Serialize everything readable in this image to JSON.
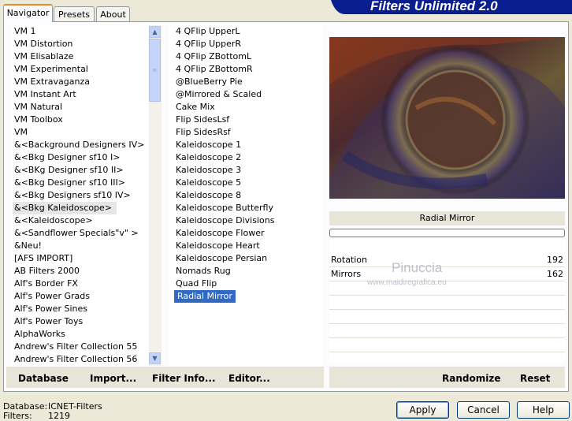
{
  "tabs": [
    "Navigator",
    "Presets",
    "About"
  ],
  "brand": "Filters Unlimited 2.0",
  "categories": [
    "VM 1",
    "VM Distortion",
    "VM Elisablaze",
    "VM Experimental",
    "VM Extravaganza",
    "VM Instant Art",
    "VM Natural",
    "VM Toolbox",
    "VM",
    "&<Background Designers IV>",
    "&<Bkg Designer sf10 I>",
    "&<BKg Designer sf10 II>",
    "&<Bkg Designer sf10 III>",
    "&<Bkg Designers sf10 IV>",
    "&<Bkg Kaleidoscope>",
    "&<Kaleidoscope>",
    "&<Sandflower Specials\"v\" >",
    "&Neu!",
    "[AFS IMPORT]",
    "AB Filters 2000",
    "Alf's Border FX",
    "Alf's Power Grads",
    "Alf's Power Sines",
    "Alf's Power Toys",
    "AlphaWorks",
    "Andrew's Filter Collection 55",
    "Andrew's Filter Collection 56"
  ],
  "filters": [
    "4 QFlip UpperL",
    "4 QFlip UpperR",
    "4 QFlip ZBottomL",
    "4 QFlip ZBottomR",
    "@BlueBerry Pie",
    "@Mirrored & Scaled",
    "Cake Mix",
    "Flip SidesLsf",
    "Flip SidesRsf",
    "Kaleidoscope 1",
    "Kaleidoscope 2",
    "Kaleidoscope 3",
    "Kaleidoscope 5",
    "Kaleidoscope 8",
    "Kaleidoscope Butterfly",
    "Kaleidoscope Divisions",
    "Kaleidoscope Flower",
    "Kaleidoscope Heart",
    "Kaleidoscope Persian",
    "Nomads Rug",
    "Quad Flip",
    "Radial Mirror"
  ],
  "filter_name": "Radial Mirror",
  "params": [
    {
      "label": "Rotation",
      "value": "192"
    },
    {
      "label": "Mirrors",
      "value": "162"
    }
  ],
  "watermark": {
    "line1": "Pinuccia",
    "line2": "www.maidiregrafica.eu"
  },
  "left_buttons": [
    "Database",
    "Import...",
    "Filter Info...",
    "Editor..."
  ],
  "right_buttons": [
    "Randomize",
    "Reset"
  ],
  "status": {
    "database_label": "Database:",
    "database_value": "ICNET-Filters",
    "filters_label": "Filters:",
    "filters_value": "1219"
  },
  "dialog_buttons": [
    "Apply",
    "Cancel",
    "Help"
  ]
}
